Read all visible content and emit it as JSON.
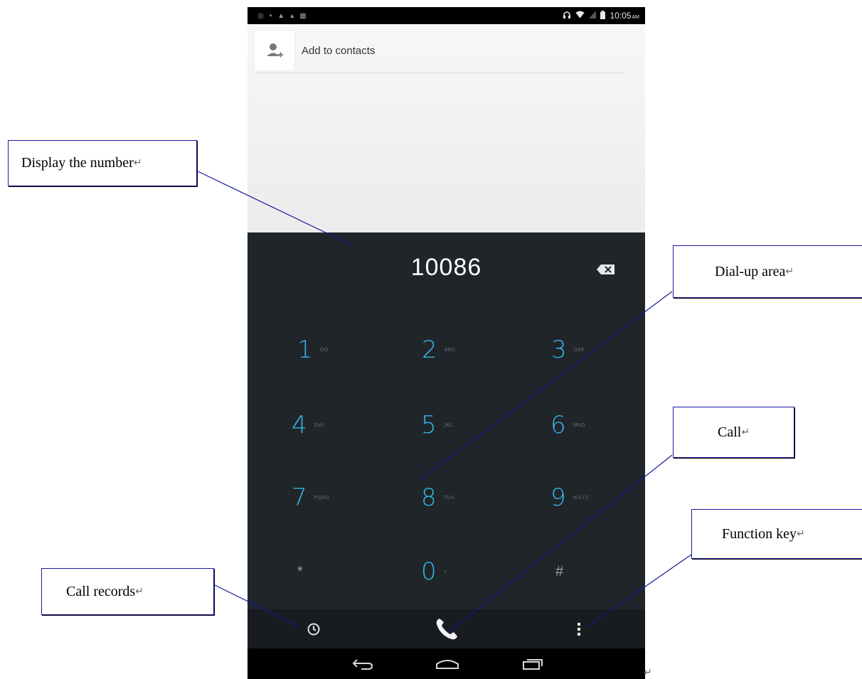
{
  "status_bar": {
    "time": "10:05",
    "ampm": "AM"
  },
  "contacts": {
    "add_label": "Add to contacts"
  },
  "dialer": {
    "number": "10086",
    "keys": [
      {
        "digit": "1",
        "letters": "QO"
      },
      {
        "digit": "2",
        "letters": "ABC"
      },
      {
        "digit": "3",
        "letters": "DEF"
      },
      {
        "digit": "4",
        "letters": "GHI"
      },
      {
        "digit": "5",
        "letters": "JKL"
      },
      {
        "digit": "6",
        "letters": "MNO"
      },
      {
        "digit": "7",
        "letters": "PQRS"
      },
      {
        "digit": "8",
        "letters": "TUV"
      },
      {
        "digit": "9",
        "letters": "WXYZ"
      },
      {
        "digit": "*",
        "letters": ""
      },
      {
        "digit": "0",
        "letters": "+"
      },
      {
        "digit": "#",
        "letters": ""
      }
    ]
  },
  "annotations": {
    "display_number": "Display the number",
    "dial_area": "Dial-up area",
    "call": "Call",
    "function_key": "Function key",
    "call_records": "Call records",
    "mark": "↵"
  },
  "colors": {
    "accent": "#33b5e5",
    "dialer_bg": "#20252a",
    "callout_border": "#1a1aa0"
  },
  "icons": [
    "add-contact-icon",
    "backspace-icon",
    "call-history-icon",
    "phone-icon",
    "overflow-menu-icon",
    "back-icon",
    "home-icon",
    "recents-icon"
  ]
}
